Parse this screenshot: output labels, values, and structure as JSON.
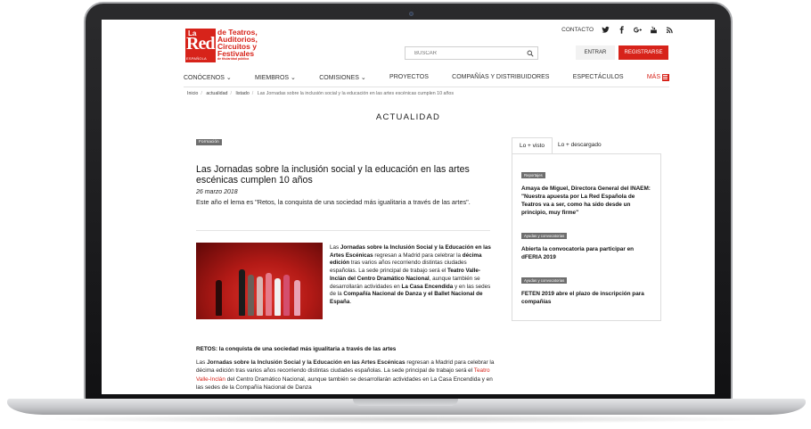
{
  "header": {
    "logo": {
      "la": "La",
      "red": "Red",
      "lines": [
        "de Teatros,",
        "Auditorios,",
        "Circuitos y",
        "Festivales"
      ],
      "small": "de titularidad pública",
      "esp": "ESPAÑOLA"
    },
    "contact_label": "CONTACTO",
    "social": [
      "twitter-icon",
      "facebook-icon",
      "google-plus-icon",
      "youtube-icon",
      "rss-icon"
    ],
    "search": {
      "placeholder": "BUSCAR"
    },
    "login_label": "ENTRAR",
    "register_label": "REGISTRARSE",
    "accent_color": "#d7231a"
  },
  "nav": {
    "items": [
      "CONÓCENOS ⌄",
      "MIEMBROS ⌄",
      "COMISIONES ⌄",
      "PROYECTOS",
      "COMPAÑÍAS Y DISTRIBUIDORES",
      "ESPECTÁCULOS"
    ],
    "more_label": "MÁS"
  },
  "breadcrumb": {
    "items": [
      "Inicio",
      "actualidad",
      "listado"
    ],
    "current": "Las Jornadas sobre la inclusión social y la educación en las artes escénicas cumplen 10 años"
  },
  "section_title": "ACTUALIDAD",
  "article": {
    "tag": "Formación",
    "title": "Las Jornadas sobre la inclusión social y la educación en las artes escénicas cumplen 10 años",
    "date": "26 marzo 2018",
    "lead": "Este año el lema es \"Retos, la conquista de una sociedad más igualitaria a través de las artes\".",
    "body": {
      "t1": "Las ",
      "b1": "Jornadas sobre la Inclusión Social y la Educación en las Artes Escénicas",
      "t2": " regresan a Madrid para celebrar la ",
      "b2": "décima edición",
      "t3": " tras varios años recorriendo distintas ciudades españolas. La sede principal de trabajo será el ",
      "b3": "Teatro Valle-Inclán del Centro Dramático Nacional",
      "t4": ", aunque también se desarrollarán actividades en ",
      "b4": "La Casa Encendida",
      "t5": " y en las sedes de la ",
      "b5": "Compañía Nacional de Danza y el Ballet Nacional de España",
      "t6": "."
    },
    "retos_heading": "RETOS: la conquista de una sociedad más igualitaria a través de las artes",
    "body2": {
      "t1": "Las ",
      "b1": "Jornadas sobre la Inclusión Social y la Educación en las Artes Escénicas",
      "t2": " regresan a Madrid para celebrar la décima edición tras varios años recorriendo distintas ciudades españolas. La sede principal de trabajo será el ",
      "r1": "Teatro Valle-Inclán",
      "t3": "  del Centro Dramático Nacional, aunque también se desarrollarán actividades en La Casa Encendida y en las sedes de la Compañía Nacional de Danza"
    }
  },
  "sidebar": {
    "tabs": [
      "Lo + visto",
      "Lo + descargado"
    ],
    "items": [
      {
        "tag": "Reportajes",
        "title": "Amaya de Miguel, Directora General del INAEM: \"Nuestra apuesta por La Red Española de Teatros va a ser, como ha sido desde un principio, muy firme\""
      },
      {
        "tag": "Ayudas y convocatorias",
        "title": "Abierta la convocatoria para participar en dFERIA 2019"
      },
      {
        "tag": "Ayudas y convocatorias",
        "title": "FETEN 2019 abre el plazo de inscripción para compañías"
      }
    ]
  }
}
